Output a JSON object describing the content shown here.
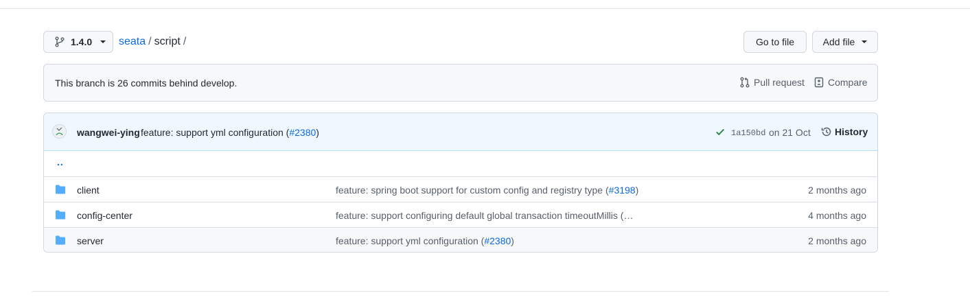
{
  "branch": {
    "name": "1.4.0"
  },
  "breadcrumb": {
    "repo": "seata",
    "sep1": "/",
    "folder": "script",
    "sep2": "/"
  },
  "actions": {
    "goto_file": "Go to file",
    "add_file": "Add file"
  },
  "banner": {
    "text": "This branch is 26 commits behind develop.",
    "pull_request": "Pull request",
    "compare": "Compare"
  },
  "latest_commit": {
    "author": "wangwei-ying",
    "message": "feature: support yml configuration (",
    "pr_ref": "#2380",
    "message_end": ")",
    "sha": "1a150bd",
    "date": "on 21 Oct",
    "history": "History"
  },
  "parent_dir": "..",
  "files": [
    {
      "name": "client",
      "message": "feature: spring boot support for custom config and registry type (",
      "pr_ref": "#3198",
      "message_end": ")",
      "age": "2 months ago"
    },
    {
      "name": "config-center",
      "message": "feature: support configuring default global transaction timeoutMillis (…",
      "pr_ref": "",
      "message_end": "",
      "age": "4 months ago"
    },
    {
      "name": "server",
      "message": "feature: support yml configuration (",
      "pr_ref": "#2380",
      "message_end": ")",
      "age": "2 months ago"
    }
  ],
  "colors": {
    "link": "#0969da",
    "folder": "#54aeff",
    "check": "#1a7f37"
  }
}
